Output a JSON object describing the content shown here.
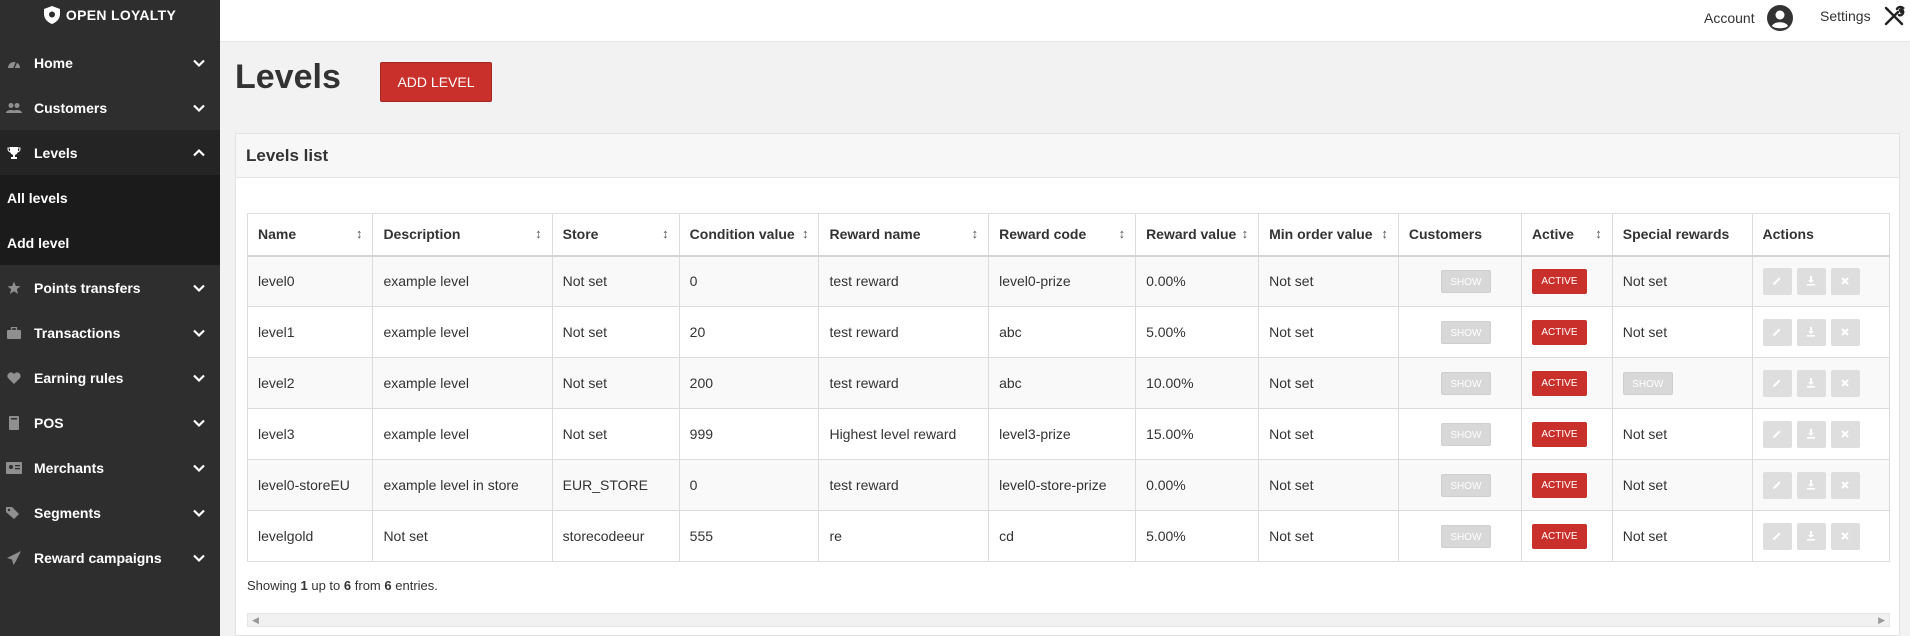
{
  "brand": {
    "name": "OPEN LOYALTY"
  },
  "sidebar": {
    "items": [
      {
        "label": "Home",
        "icon": "dashboard-icon"
      },
      {
        "label": "Customers",
        "icon": "users-icon"
      },
      {
        "label": "Levels",
        "icon": "trophy-icon",
        "expanded": true,
        "subitems": [
          {
            "label": "All levels"
          },
          {
            "label": "Add level"
          }
        ]
      },
      {
        "label": "Points transfers",
        "icon": "star-icon"
      },
      {
        "label": "Transactions",
        "icon": "briefcase-icon"
      },
      {
        "label": "Earning rules",
        "icon": "heart-icon"
      },
      {
        "label": "POS",
        "icon": "book-icon"
      },
      {
        "label": "Merchants",
        "icon": "id-card-icon"
      },
      {
        "label": "Segments",
        "icon": "tags-icon"
      },
      {
        "label": "Reward campaigns",
        "icon": "paper-plane-icon"
      }
    ]
  },
  "header": {
    "account_label": "Account",
    "settings_label": "Settings"
  },
  "page": {
    "title": "Levels",
    "add_button": "ADD LEVEL"
  },
  "panel": {
    "title": "Levels list"
  },
  "table": {
    "columns": [
      "Name",
      "Description",
      "Store",
      "Condition value",
      "Reward name",
      "Reward code",
      "Reward value",
      "Min order value",
      "Customers",
      "Active",
      "Special rewards",
      "Actions"
    ],
    "sortable": [
      true,
      true,
      true,
      true,
      true,
      true,
      true,
      true,
      false,
      true,
      false,
      false
    ],
    "rows": [
      {
        "name": "level0",
        "description": "example level",
        "store": "Not set",
        "condition_value": "0",
        "reward_name": "test reward",
        "reward_code": "level0-prize",
        "reward_value": "0.00%",
        "min_order_value": "Not set",
        "customers": "SHOW",
        "active": "ACTIVE",
        "special_rewards": "Not set",
        "special_is_button": false
      },
      {
        "name": "level1",
        "description": "example level",
        "store": "Not set",
        "condition_value": "20",
        "reward_name": "test reward",
        "reward_code": "abc",
        "reward_value": "5.00%",
        "min_order_value": "Not set",
        "customers": "SHOW",
        "active": "ACTIVE",
        "special_rewards": "Not set",
        "special_is_button": false
      },
      {
        "name": "level2",
        "description": "example level",
        "store": "Not set",
        "condition_value": "200",
        "reward_name": "test reward",
        "reward_code": "abc",
        "reward_value": "10.00%",
        "min_order_value": "Not set",
        "customers": "SHOW",
        "active": "ACTIVE",
        "special_rewards": "SHOW",
        "special_is_button": true
      },
      {
        "name": "level3",
        "description": "example level",
        "store": "Not set",
        "condition_value": "999",
        "reward_name": "Highest level reward",
        "reward_code": "level3-prize",
        "reward_value": "15.00%",
        "min_order_value": "Not set",
        "customers": "SHOW",
        "active": "ACTIVE",
        "special_rewards": "Not set",
        "special_is_button": false
      },
      {
        "name": "level0-storeEU",
        "description": "example level in store",
        "store": "EUR_STORE",
        "condition_value": "0",
        "reward_name": "test reward",
        "reward_code": "level0-store-prize",
        "reward_value": "0.00%",
        "min_order_value": "Not set",
        "customers": "SHOW",
        "active": "ACTIVE",
        "special_rewards": "Not set",
        "special_is_button": false
      },
      {
        "name": "levelgold",
        "description": "Not set",
        "store": "storecodeeur",
        "condition_value": "555",
        "reward_name": "re",
        "reward_code": "cd",
        "reward_value": "5.00%",
        "min_order_value": "Not set",
        "customers": "SHOW",
        "active": "ACTIVE",
        "special_rewards": "Not set",
        "special_is_button": false
      }
    ]
  },
  "pagination": {
    "prefix": "Showing",
    "from": "1",
    "mid1": "up to",
    "to": "6",
    "mid2": "from",
    "total": "6",
    "suffix": "entries."
  },
  "colors": {
    "sidebar_bg": "#2e2e2e",
    "accent_red": "#c9302c",
    "muted_button": "#d8d8d8"
  }
}
